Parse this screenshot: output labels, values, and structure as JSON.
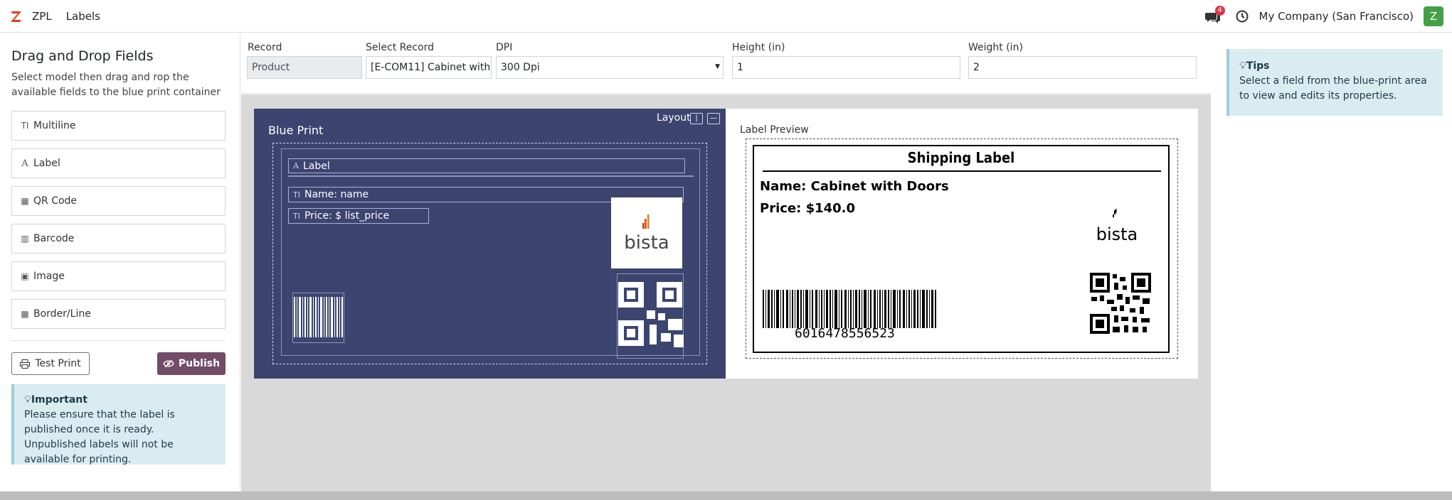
{
  "navbar": {
    "app_name": "ZPL",
    "menu_label": "Labels",
    "message_count": "4",
    "company": "My Company (San Francisco)",
    "avatar_initial": "Z",
    "brand_color": "#e03c1f",
    "avatar_color": "#43a047"
  },
  "sidebar": {
    "title": "Drag and Drop Fields",
    "description": "Select model then drag and rop the available fields to the blue print container",
    "fields": [
      {
        "label": "Multiline",
        "icon": "text-height-icon"
      },
      {
        "label": "Label",
        "icon": "font-icon"
      },
      {
        "label": "QR Code",
        "icon": "qrcode-icon"
      },
      {
        "label": "Barcode",
        "icon": "barcode-icon"
      },
      {
        "label": "Image",
        "icon": "image-icon"
      },
      {
        "label": "Border/Line",
        "icon": "th-icon"
      }
    ],
    "test_print_label": "Test Print",
    "publish_label": "Publish",
    "publish_color": "#714b67",
    "important_title": "Important",
    "important_text": "Please ensure that the label is published once it is ready. Unpublished labels will not be available for printing."
  },
  "toolbar": {
    "record_label": "Record",
    "record_value": "Product",
    "select_record_label": "Select Record",
    "select_record_value": "[E-COM11] Cabinet with",
    "dpi_label": "DPI",
    "dpi_value": "300 Dpi",
    "height_label": "Height (in)",
    "height_value": "1",
    "weight_label": "Weight (in)",
    "weight_value": "2"
  },
  "blueprint": {
    "title": "Blue Print",
    "layout_label": "Layout",
    "layout_btn_vertical": "|",
    "layout_btn_horizontal": "—",
    "fields": {
      "label": "Label",
      "name": "Name: name",
      "price": "Price: $ list_price"
    },
    "background_color": "#3b4570"
  },
  "preview": {
    "title": "Label Preview",
    "heading": "Shipping Label",
    "name_line": "Name: Cabinet with Doors",
    "price_line": "Price: $140.0",
    "barcode_number": "6016478556523",
    "logo_text": "bista"
  },
  "tips": {
    "title": "Tips",
    "text": "Select a field from the blue-print area to view and edits its properties."
  }
}
